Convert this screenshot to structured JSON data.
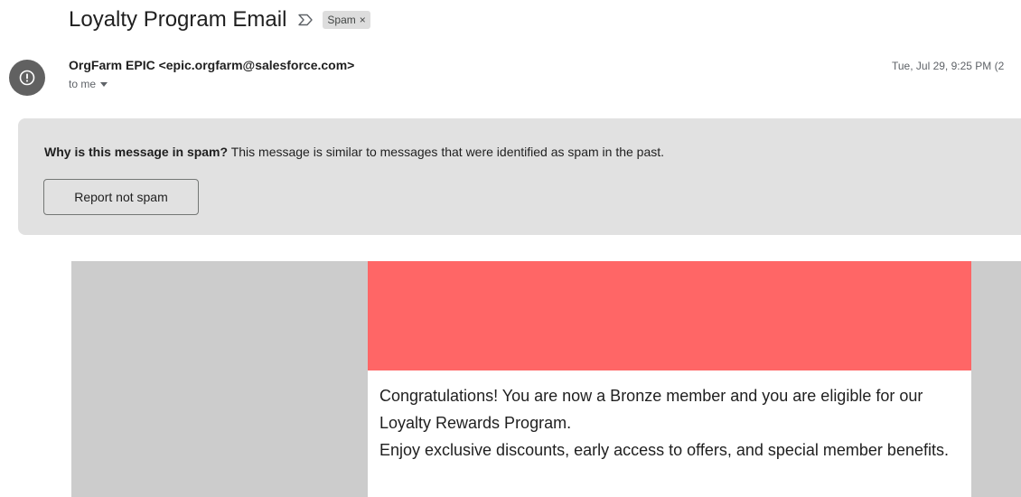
{
  "email": {
    "subject": "Loyalty Program Email",
    "label": "Spam",
    "sender": "OrgFarm EPIC <epic.orgfarm@salesforce.com>",
    "recipient": "to me",
    "timestamp": "Tue, Jul 29, 9:25 PM (2"
  },
  "spam_banner": {
    "question": "Why is this message in spam?",
    "explanation": " This message is similar to messages that were identified as spam in the past.",
    "button_label": "Report not spam"
  },
  "body": {
    "banner_color": "#ff6666",
    "paragraph_1": "Congratulations! You are now a Bronze member and you are eligible for our Loyalty Rewards Program.",
    "paragraph_2": "Enjoy exclusive discounts, early access to offers, and special member benefits."
  },
  "icons": {
    "important": "importance-marker-icon",
    "avatar": "spam-alert-icon",
    "label_remove": "close-icon",
    "recipient_details": "chevron-down-icon"
  }
}
